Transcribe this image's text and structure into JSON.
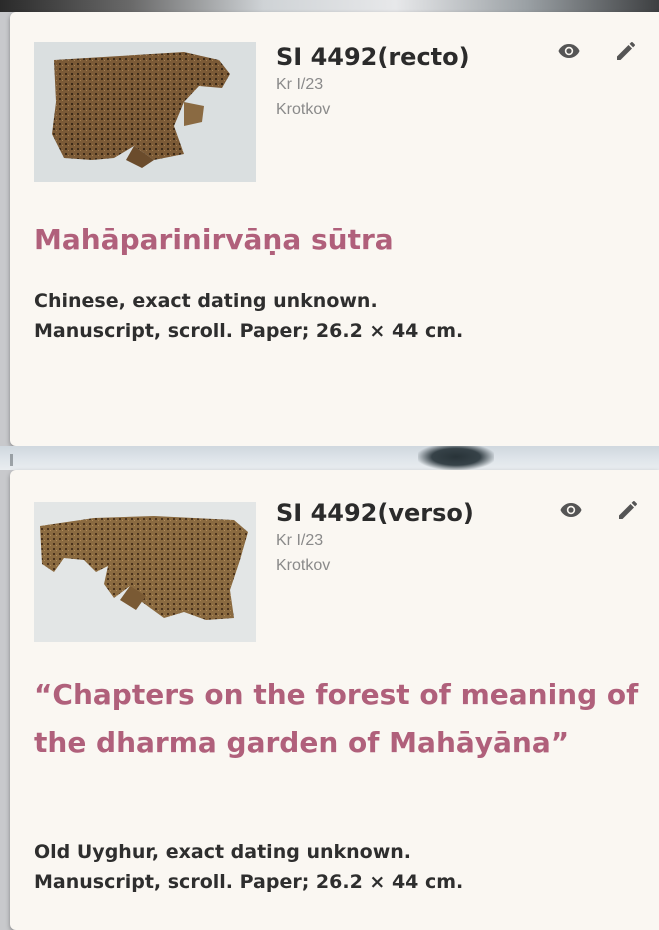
{
  "records": [
    {
      "shelfmark": "SI 4492(recto)",
      "inventory": "Kr I/23",
      "collector": "Krotkov",
      "title": "Mahāparinirvāṇa sūtra",
      "desc_line1": "Chinese, exact dating unknown.",
      "desc_line2": "Manuscript, scroll. Paper; 26.2 × 44 cm."
    },
    {
      "shelfmark": "SI 4492(verso)",
      "inventory": "Kr I/23",
      "collector": "Krotkov",
      "title": "“Chapters on the forest of meaning of the dharma garden of Mahāyāna”",
      "desc_line1": "Old Uyghur, exact dating unknown.",
      "desc_line2": "Manuscript, scroll. Paper; 26.2 × 44 cm."
    }
  ],
  "icons": {
    "view": "eye-icon",
    "edit": "pencil-icon"
  },
  "colors": {
    "title": "#b0607b",
    "card_bg": "#faf7f2",
    "text_dark": "#2e2e2e",
    "text_muted": "#8a8a8a",
    "icon": "#555555"
  }
}
